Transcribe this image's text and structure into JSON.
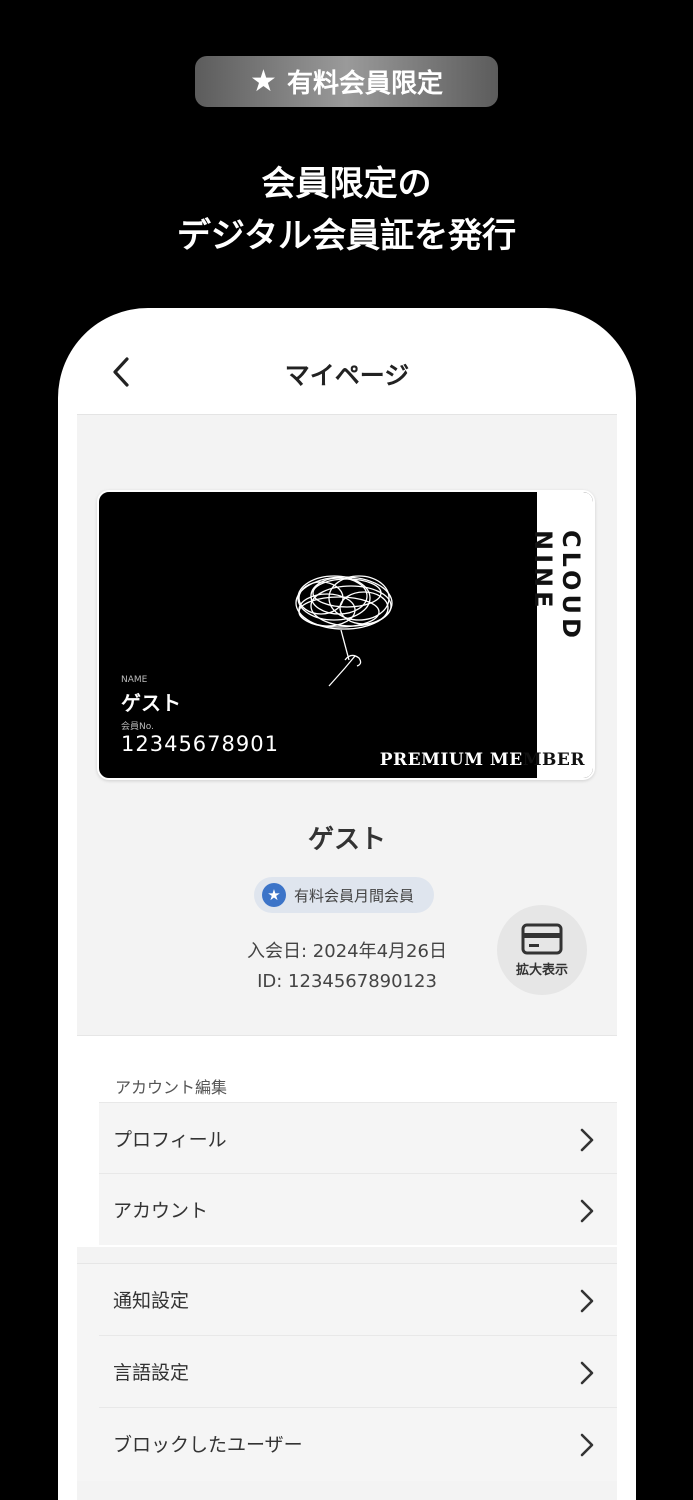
{
  "promo": {
    "badge_label": "有料会員限定",
    "headline_line1": "会員限定の",
    "headline_line2": "デジタル会員証を発行"
  },
  "nav": {
    "title": "マイページ",
    "back_icon": "chevron-left-icon"
  },
  "member_card": {
    "brand": "CLOUD NINE",
    "name_label": "NAME",
    "name": "ゲスト",
    "number_label": "会員No.",
    "number": "12345678901",
    "tier_part1": "PREMIUM ME",
    "tier_part2": "MBER"
  },
  "profile": {
    "name": "ゲスト",
    "plan": "有料会員月間会員",
    "join_date": "入会日: 2024年4月26日",
    "id": "ID: 1234567890123",
    "expand_label": "拡大表示"
  },
  "account_section": {
    "title": "アカウント編集",
    "items": [
      {
        "label": "プロフィール"
      },
      {
        "label": "アカウント"
      }
    ]
  },
  "settings_section": {
    "items": [
      {
        "label": "通知設定"
      },
      {
        "label": "言語設定"
      },
      {
        "label": "ブロックしたユーザー"
      }
    ]
  }
}
